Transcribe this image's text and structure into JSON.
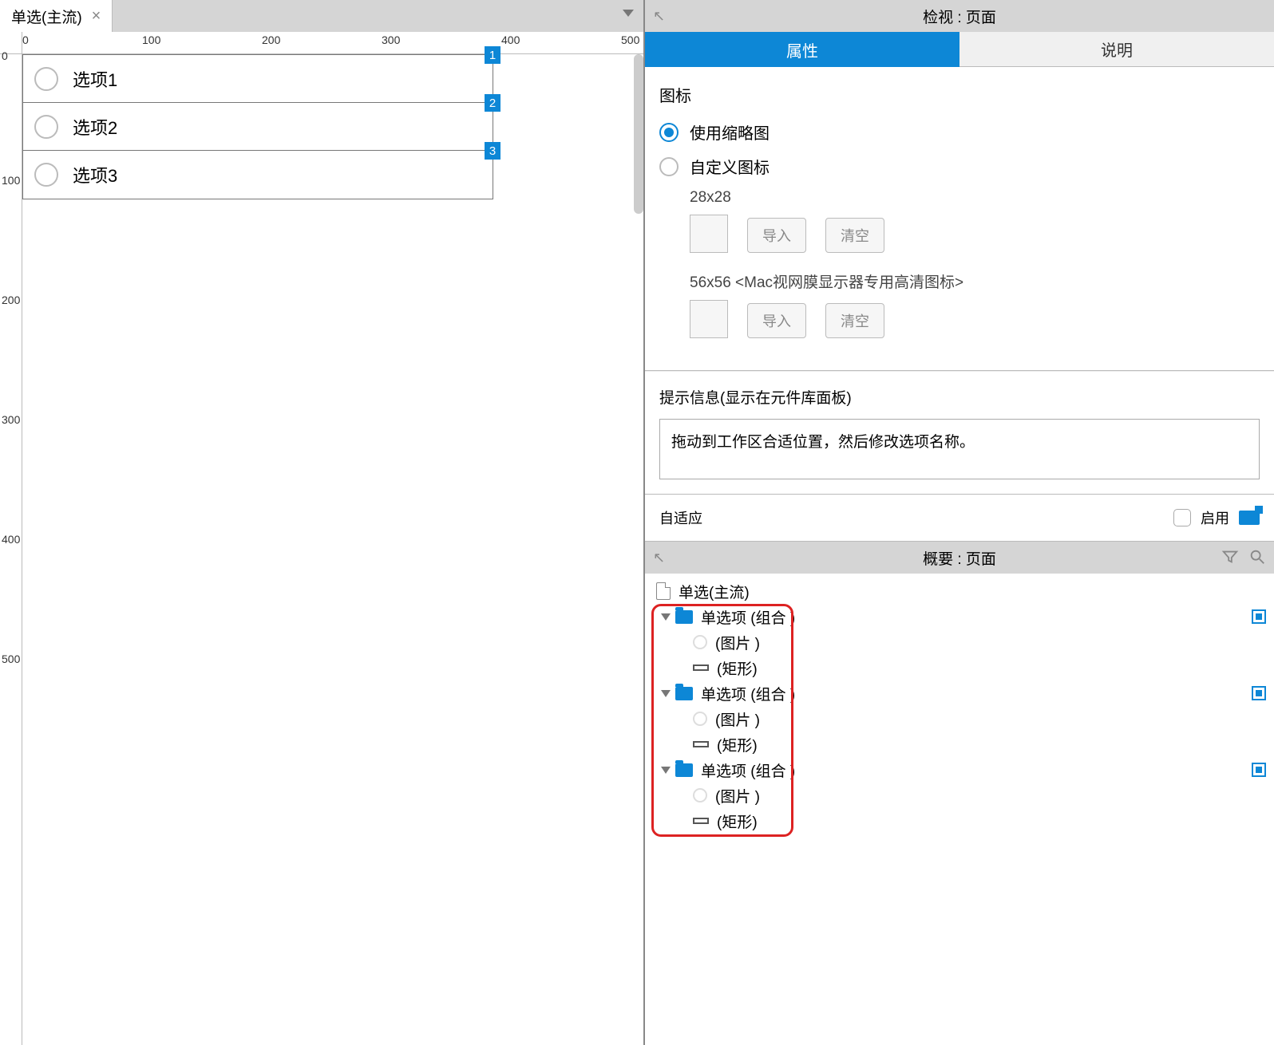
{
  "tab": {
    "label": "单选(主流)",
    "close": "×"
  },
  "ruler_h": [
    0,
    100,
    200,
    300,
    400,
    500
  ],
  "ruler_v": [
    0,
    100,
    200,
    300,
    400,
    500
  ],
  "canvas": {
    "options": [
      "选项1",
      "选项2",
      "选项3"
    ],
    "handles": [
      "1",
      "2",
      "3"
    ]
  },
  "inspector": {
    "title": "检视 : 页面",
    "tabs": {
      "props": "属性",
      "notes": "说明"
    },
    "icon_section": {
      "title": "图标",
      "use_thumb": "使用缩略图",
      "custom": "自定义图标",
      "size28": "28x28",
      "size56": "56x56 <Mac视网膜显示器专用高清图标>",
      "import": "导入",
      "clear": "清空"
    },
    "hint": {
      "title": "提示信息(显示在元件库面板)",
      "text": "拖动到工作区合适位置，然后修改选项名称。"
    },
    "adaptive": {
      "label": "自适应",
      "enable": "启用"
    }
  },
  "outline": {
    "title": "概要 : 页面",
    "page": "单选(主流)",
    "groups": [
      {
        "name": "单选项 (组合 )",
        "children": [
          "(图片 )",
          "(矩形)"
        ]
      },
      {
        "name": "单选项 (组合 )",
        "children": [
          "(图片 )",
          "(矩形)"
        ]
      },
      {
        "name": "单选项 (组合 )",
        "children": [
          "(图片 )",
          "(矩形)"
        ]
      }
    ]
  }
}
